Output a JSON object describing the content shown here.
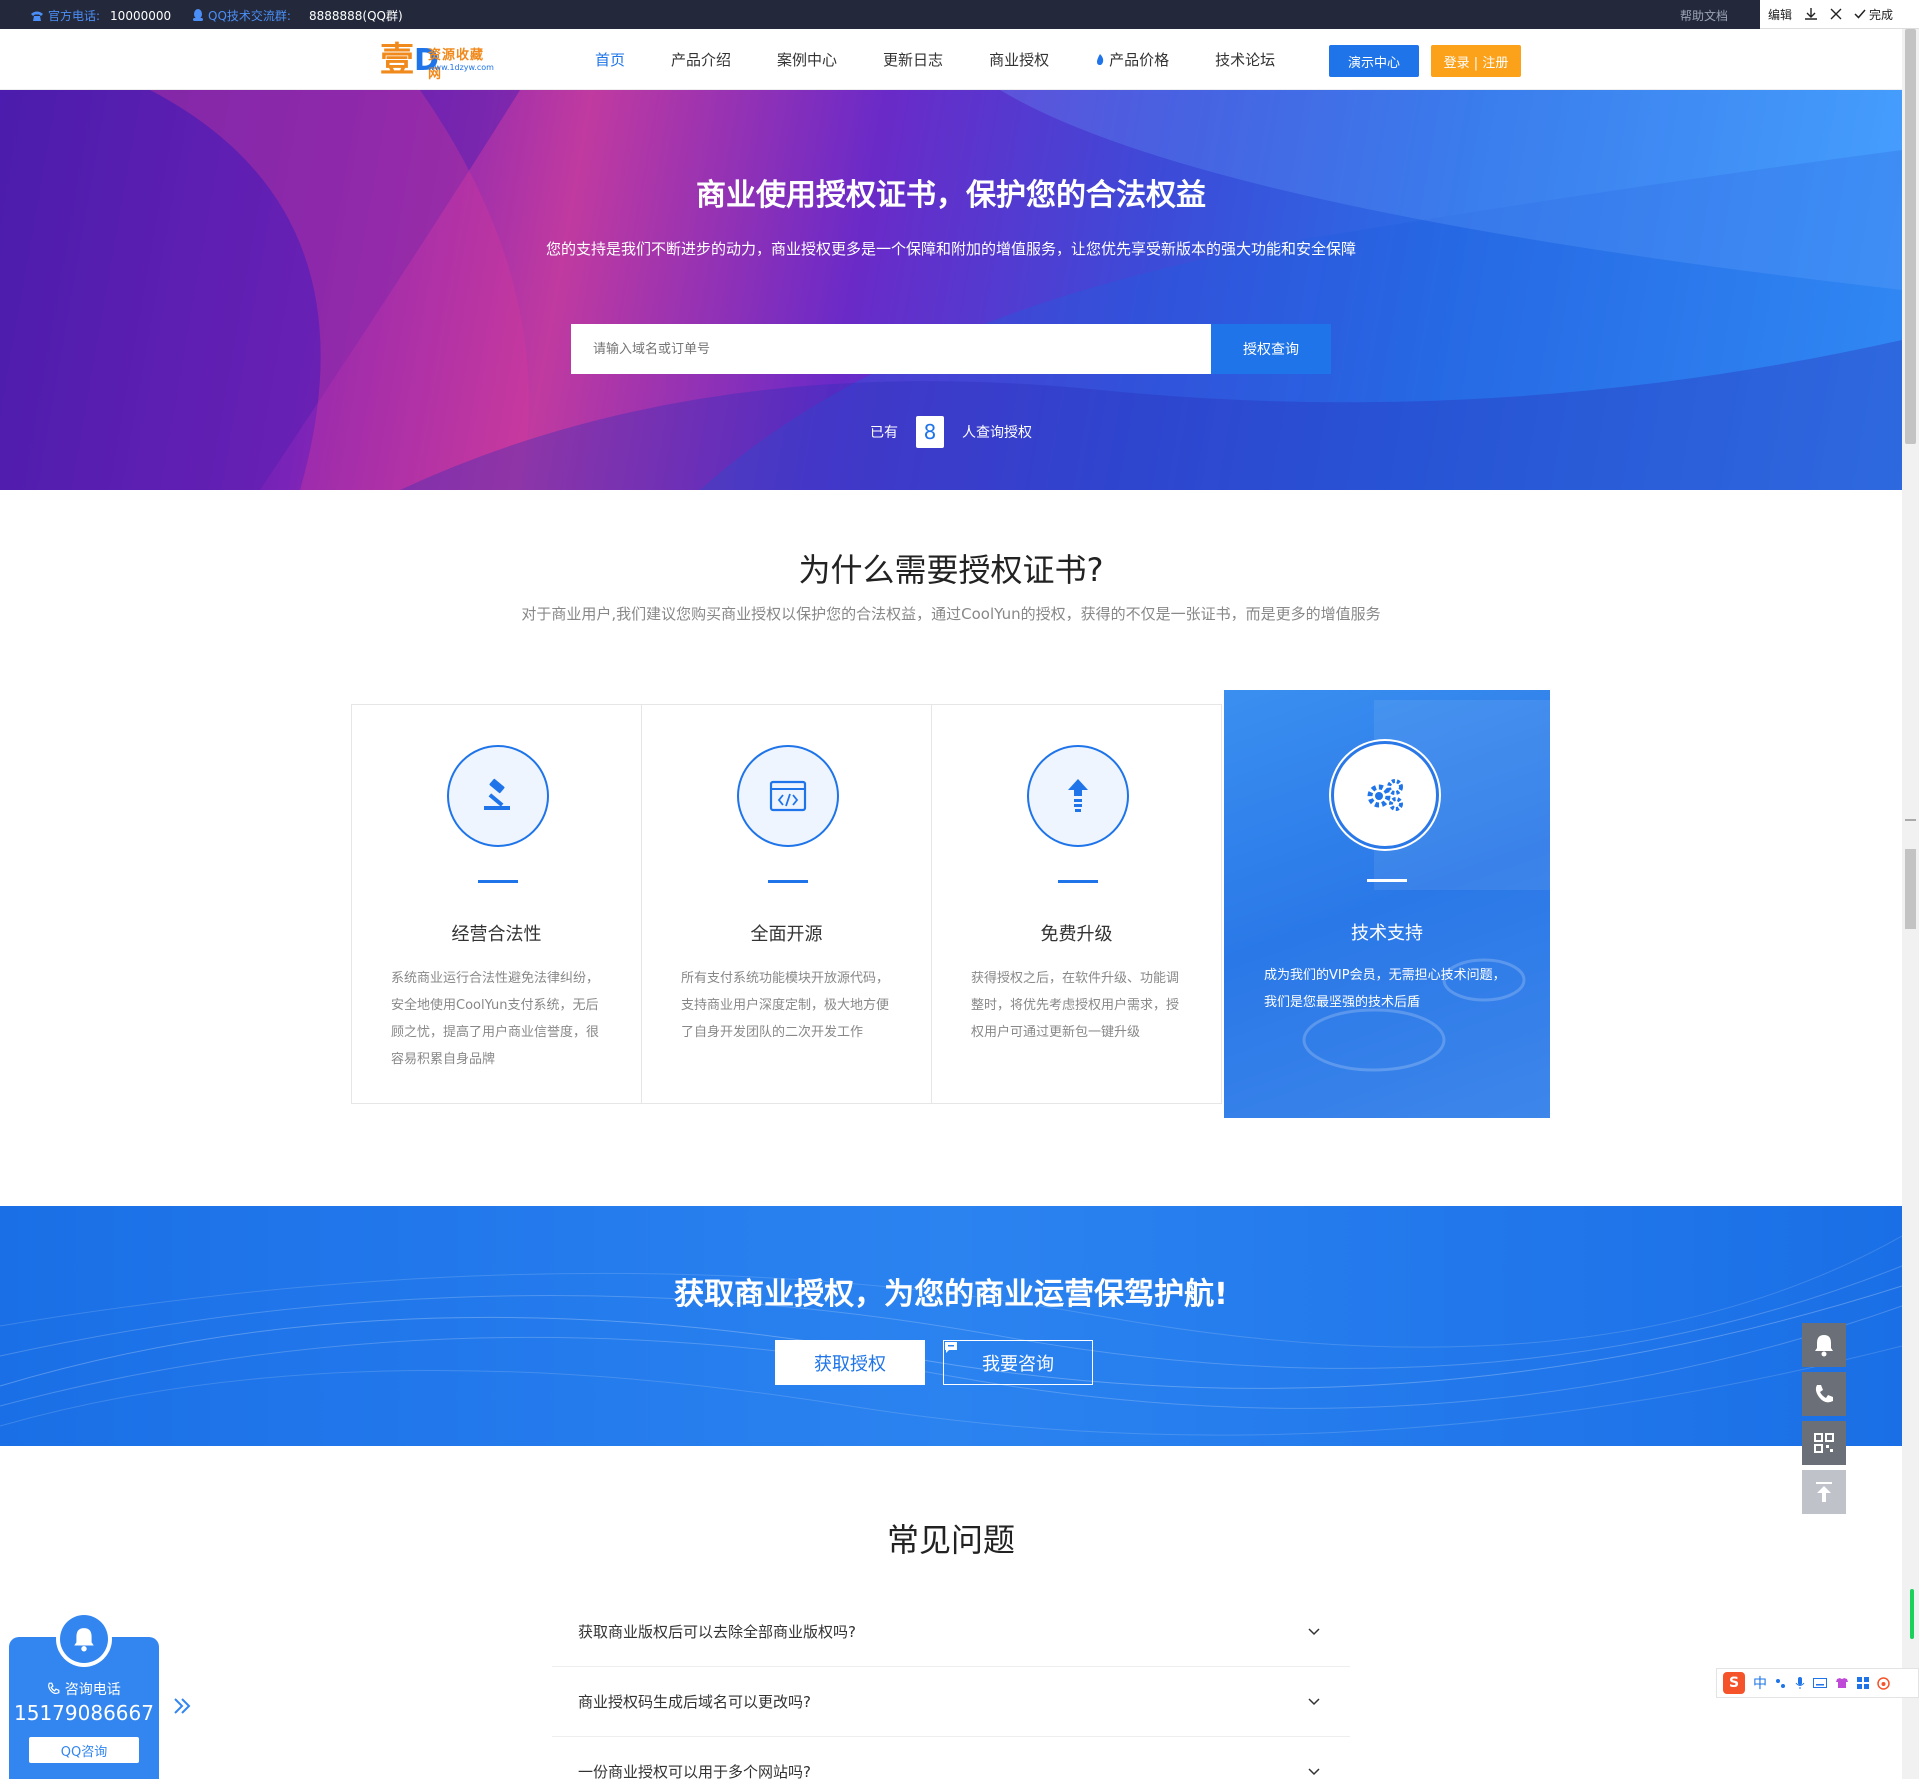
{
  "topbar": {
    "phone_label": "官方电话:",
    "phone_value": "10000000",
    "qq_label": "QQ技术交流群:",
    "qq_value": "8888888(QQ群)",
    "help": "帮助文档"
  },
  "editbar": {
    "edit": "编辑",
    "done": "完成"
  },
  "logo": {
    "big": "壹",
    "d": "D",
    "name": "资源收藏网",
    "url": "www.1dzyw.com"
  },
  "nav": {
    "items": [
      "首页",
      "产品介绍",
      "案例中心",
      "更新日志",
      "商业授权",
      "产品价格",
      "技术论坛"
    ],
    "demo": "演示中心",
    "login": "登录 | 注册"
  },
  "hero": {
    "title": "商业使用授权证书，保护您的合法权益",
    "subtitle": "您的支持是我们不断进步的动力，商业授权更多是一个保障和附加的增值服务，让您优先享受新版本的强大功能和安全保障",
    "search_placeholder": "请输入域名或订单号",
    "search_button": "授权查询",
    "count_prefix": "已有",
    "count": "8",
    "count_suffix": "人查询授权"
  },
  "why": {
    "title": "为什么需要授权证书?",
    "subtitle": "对于商业用户,我们建议您购买商业授权以保护您的合法权益，通过CoolYun的授权，获得的不仅是一张证书，而是更多的增值服务",
    "cards": [
      {
        "icon": "gavel-icon",
        "name": "经营合法性",
        "desc": "系统商业运行合法性避免法律纠纷，安全地使用CoolYun支付系统，无后顾之忧，提高了用户商业信誉度，很容易积累自身品牌"
      },
      {
        "icon": "code-window-icon",
        "name": "全面开源",
        "desc": "所有支付系统功能模块开放源代码，支持商业用户深度定制，极大地方便了自身开发团队的二次开发工作"
      },
      {
        "icon": "upgrade-arrow-icon",
        "name": "免费升级",
        "desc": "获得授权之后，在软件升级、功能调整时，将优先考虑授权用户需求，授权用户可通过更新包一键升级"
      },
      {
        "icon": "gears-icon",
        "name": "技术支持",
        "desc": "成为我们的VIP会员，无需担心技术问题，我们是您最坚强的技术后盾"
      }
    ]
  },
  "cta": {
    "title": "获取商业授权，为您的商业运营保驾护航!",
    "btn_get": "获取授权",
    "btn_consult": "我要咨询"
  },
  "faq": {
    "title": "常见问题",
    "items": [
      "获取商业版权后可以去除全部商业版权吗?",
      "商业授权码生成后域名可以更改吗?",
      "一份商业授权可以用于多个网站吗?"
    ]
  },
  "contact": {
    "label": "咨询电话",
    "phone": "15179086667",
    "qq": "QQ咨询"
  },
  "ime": {
    "lang": "中"
  },
  "colors": {
    "primary": "#1e74e8",
    "orange": "#fba21a",
    "dark": "#23293a"
  }
}
